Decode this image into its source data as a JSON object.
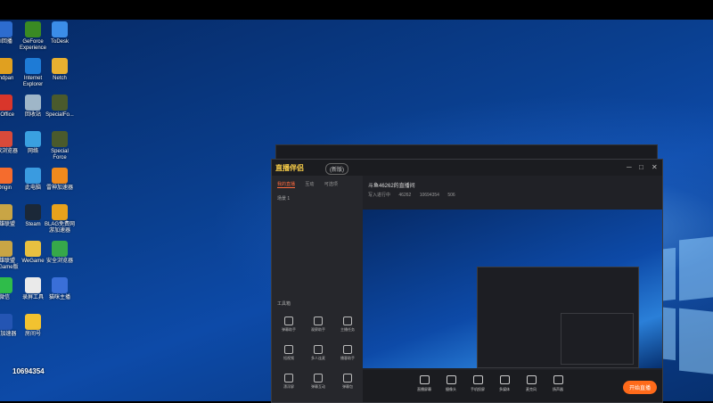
{
  "desktop": {
    "icons": [
      {
        "label": "AI回播",
        "color": "#2d6ccf"
      },
      {
        "label": "GeForce Experience",
        "color": "#3a8a23"
      },
      {
        "label": "ToDesk",
        "color": "#3b8de8"
      },
      {
        "label": "Andpan",
        "color": "#e0a020"
      },
      {
        "label": "Internet Explorer",
        "color": "#1e7bd6"
      },
      {
        "label": "Netch",
        "color": "#e8b030"
      },
      {
        "label": "G Office",
        "color": "#d9362b"
      },
      {
        "label": "回收站",
        "color": "#9fb6c8"
      },
      {
        "label": "SpecialFo...",
        "color": "#4a5a2c"
      },
      {
        "label": "谷歌浏览器",
        "color": "#d94a3a"
      },
      {
        "label": "网络",
        "color": "#3aa0e0"
      },
      {
        "label": "Special Force",
        "color": "#4a5a2c"
      },
      {
        "label": "Origin",
        "color": "#f56c2d"
      },
      {
        "label": "此电脑",
        "color": "#3a9be0"
      },
      {
        "label": "雷神加速器",
        "color": "#f08a1c"
      },
      {
        "label": "英雄联盟",
        "color": "#c9a545"
      },
      {
        "label": "Steam",
        "color": "#1b2838"
      },
      {
        "label": "BLAG免费网游加速器",
        "color": "#e8a21c"
      },
      {
        "label": "英雄联盟WeGame版",
        "color": "#c9a545"
      },
      {
        "label": "WeGame",
        "color": "#e8c040"
      },
      {
        "label": "安全浏览器",
        "color": "#36a84a"
      },
      {
        "label": "微信",
        "color": "#2fbc4a"
      },
      {
        "label": "录屏工具",
        "color": "#eaeaea"
      },
      {
        "label": "猫咪主播",
        "color": "#3a6fd8"
      },
      {
        "label": "UU加速器",
        "color": "#2455b3"
      },
      {
        "label": "房间号",
        "color": "#f2c230"
      }
    ],
    "room_number": "10694354"
  },
  "app": {
    "logo_text": "直播伴侣",
    "badge": "(新版)",
    "tabs": [
      "我的直播",
      "互动",
      "可选项"
    ],
    "scene_label": "场景 1",
    "room_title": "斗鱼46262的直播间",
    "room_tag": "播放",
    "room_meta": [
      "写入进行中",
      "46262",
      "10694354",
      "506"
    ],
    "tools_title": "工具箱",
    "tools": [
      "弹幕助手",
      "观察助手",
      "主播任务",
      "短视频",
      "多人连麦",
      "播客助手",
      "漂浮屏",
      "弹幕互动",
      "弹幕包"
    ],
    "bottom_items": [
      "直播屏幕",
      "摄像头",
      "手机投屏",
      "多媒体",
      "麦克风",
      "扬声器"
    ],
    "go_live": "开始直播",
    "window_controls": [
      "─",
      "□",
      "✕"
    ]
  }
}
